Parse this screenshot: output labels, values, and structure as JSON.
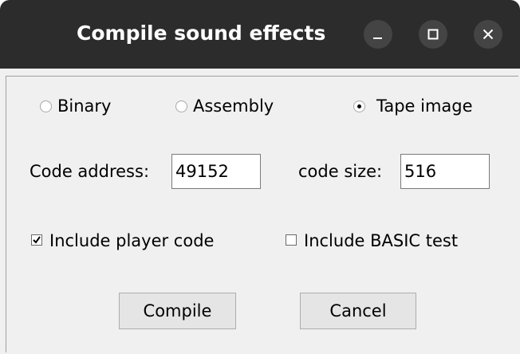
{
  "window": {
    "title": "Compile sound effects"
  },
  "output_format": {
    "options": [
      {
        "label": "Binary",
        "checked": false
      },
      {
        "label": "Assembly",
        "checked": false
      },
      {
        "label": "Tape image",
        "checked": true
      }
    ]
  },
  "code": {
    "address_label": "Code address:",
    "address_value": "49152",
    "size_label": "code size:",
    "size_value": "516"
  },
  "options": {
    "include_player_label": "Include player code",
    "include_player_checked": true,
    "include_basic_label": "Include BASIC test",
    "include_basic_checked": false
  },
  "buttons": {
    "compile_label": "Compile",
    "cancel_label": "Cancel"
  }
}
